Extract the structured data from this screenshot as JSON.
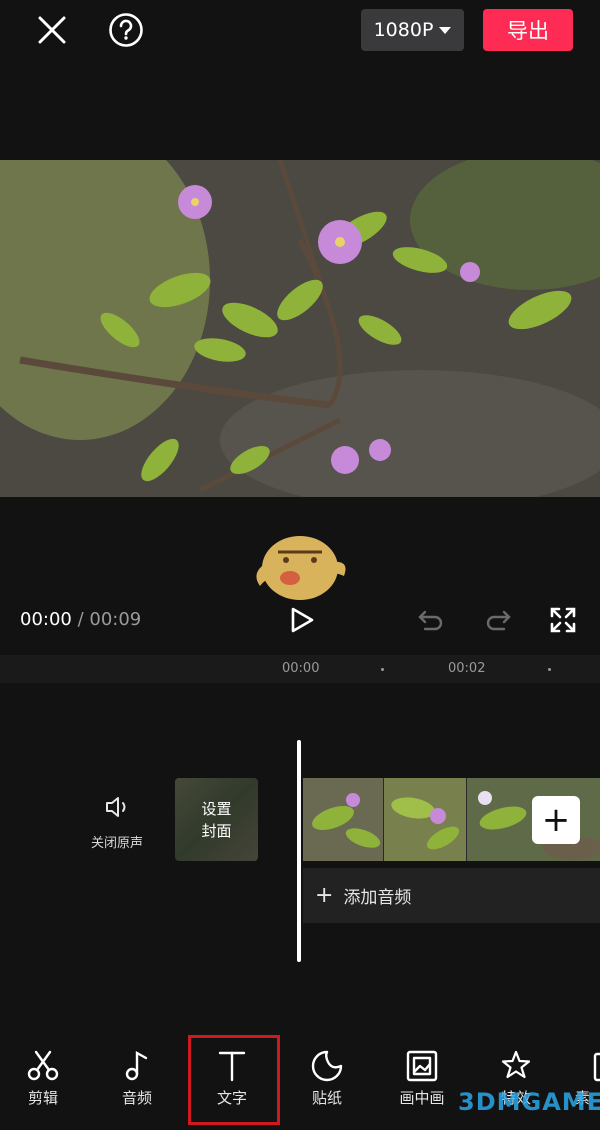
{
  "header": {
    "resolution_label": "1080P",
    "export_label": "导出"
  },
  "player": {
    "current_time": "00:00",
    "separator": " / ",
    "total_time": "00:09"
  },
  "ruler": {
    "ticks": [
      "00:00",
      "00:02"
    ]
  },
  "timeline": {
    "mute_label": "关闭原声",
    "cover_label_line1": "设置",
    "cover_label_line2": "封面",
    "add_audio_label": "添加音频"
  },
  "toolbar": {
    "items": [
      {
        "label": "剪辑",
        "icon": "scissors-icon"
      },
      {
        "label": "音频",
        "icon": "music-note-icon"
      },
      {
        "label": "文字",
        "icon": "text-icon"
      },
      {
        "label": "贴纸",
        "icon": "sticker-icon"
      },
      {
        "label": "画中画",
        "icon": "picture-in-picture-icon"
      },
      {
        "label": "特效",
        "icon": "effects-star-icon"
      },
      {
        "label": "素",
        "icon": "material-icon"
      }
    ]
  },
  "watermark": "3DMGAME",
  "colors": {
    "accent": "#fe2c55",
    "highlight_box": "#d0191d",
    "background": "#121212"
  }
}
